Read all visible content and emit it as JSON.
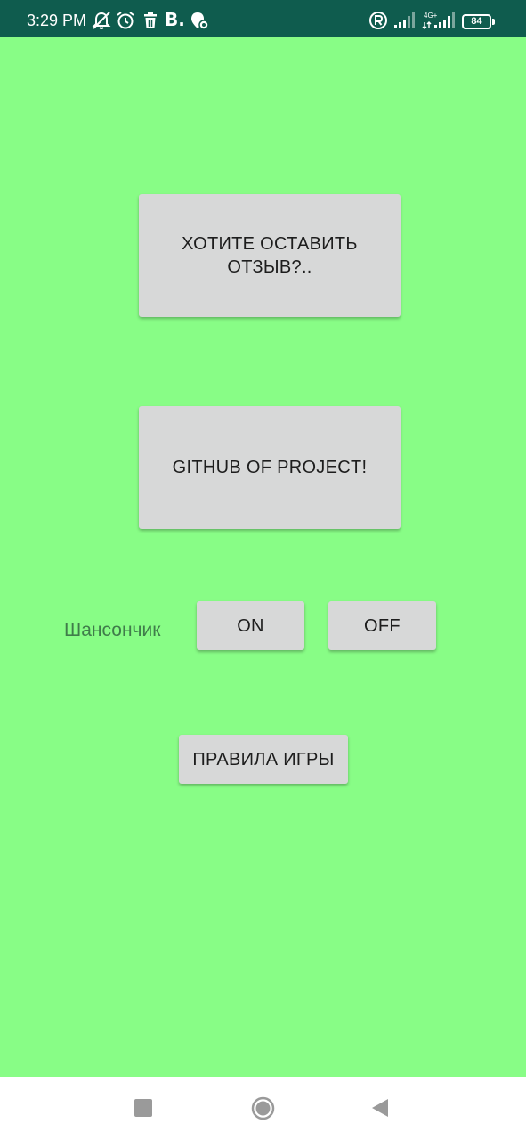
{
  "status_bar": {
    "time": "3:29 PM",
    "brand_letter": "B.",
    "network_type": "4G+",
    "battery_level": "84",
    "icons": [
      "bell-muted-icon",
      "alarm-icon",
      "trash-icon",
      "vk-icon",
      "location-icon",
      "registered-icon",
      "signal-icon",
      "signal-4g-icon",
      "battery-icon"
    ]
  },
  "main": {
    "feedback_button": "ХОТИТЕ ОСТАВИТЬ ОТЗЫВ?..",
    "github_button": "GITHUB OF PROJECT!",
    "chanson_label": "Шансончик",
    "on_button": "ON",
    "off_button": "OFF",
    "rules_button": "ПРАВИЛА ИГРЫ"
  },
  "nav_bar": {
    "icons": [
      "recents-square-icon",
      "home-circle-icon",
      "back-triangle-icon"
    ]
  },
  "colors": {
    "background": "#88fd86",
    "status_bar": "#0f5c4e",
    "button": "#d7d8d8",
    "label_text": "#3f7c4a"
  }
}
